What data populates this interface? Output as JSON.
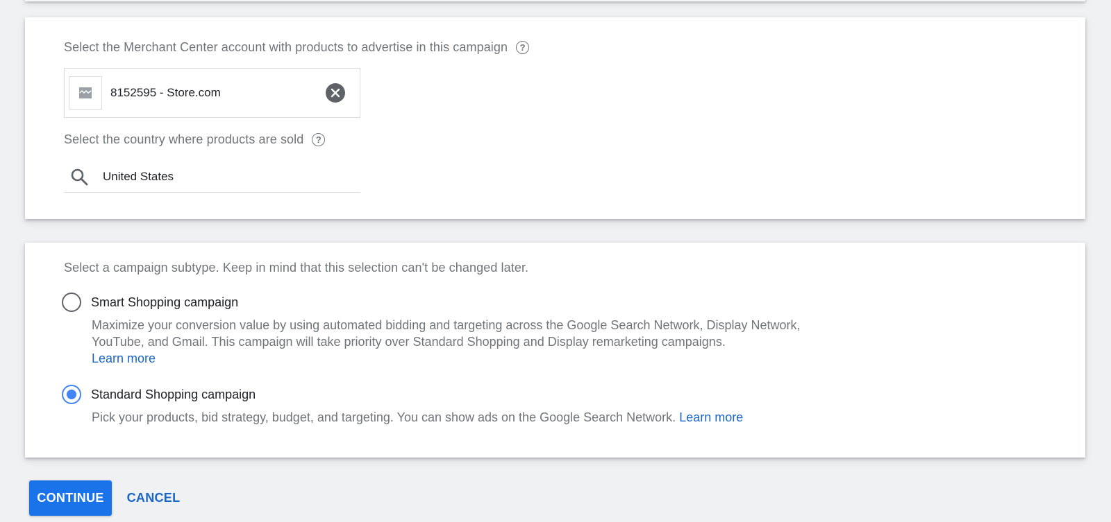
{
  "merchant_section": {
    "label": "Select the Merchant Center account with products to advertise in this campaign",
    "help_icon": "help-circle-icon",
    "selected_account": "8152595 - Store.com",
    "thumbnail_icon": "image-placeholder-icon",
    "clear_icon": "clear-circle-icon"
  },
  "country_section": {
    "label": "Select the country where products are sold",
    "help_icon": "help-circle-icon",
    "search_icon": "search-icon",
    "value": "United States"
  },
  "subtype_section": {
    "label": "Select a campaign subtype. Keep in mind that this selection can't be changed later.",
    "options": [
      {
        "label": "Smart Shopping campaign",
        "selected": false,
        "description": "Maximize your conversion value by using automated bidding and targeting across the Google Search Network, Display Network, YouTube, and Gmail. This campaign will take priority over Standard Shopping and Display remarketing campaigns.",
        "link": "Learn more"
      },
      {
        "label": "Standard Shopping campaign",
        "selected": true,
        "description": "Pick your products, bid strategy, budget, and targeting. You can show ads on the Google Search Network.",
        "link": "Learn more"
      }
    ]
  },
  "actions": {
    "continue_label": "CONTINUE",
    "cancel_label": "CANCEL"
  },
  "colors": {
    "primary": "#1a73e8",
    "radio_selected": "#4285f4",
    "link": "#1a66c9",
    "secondary_text": "#70757a",
    "background": "#eff1f3"
  }
}
